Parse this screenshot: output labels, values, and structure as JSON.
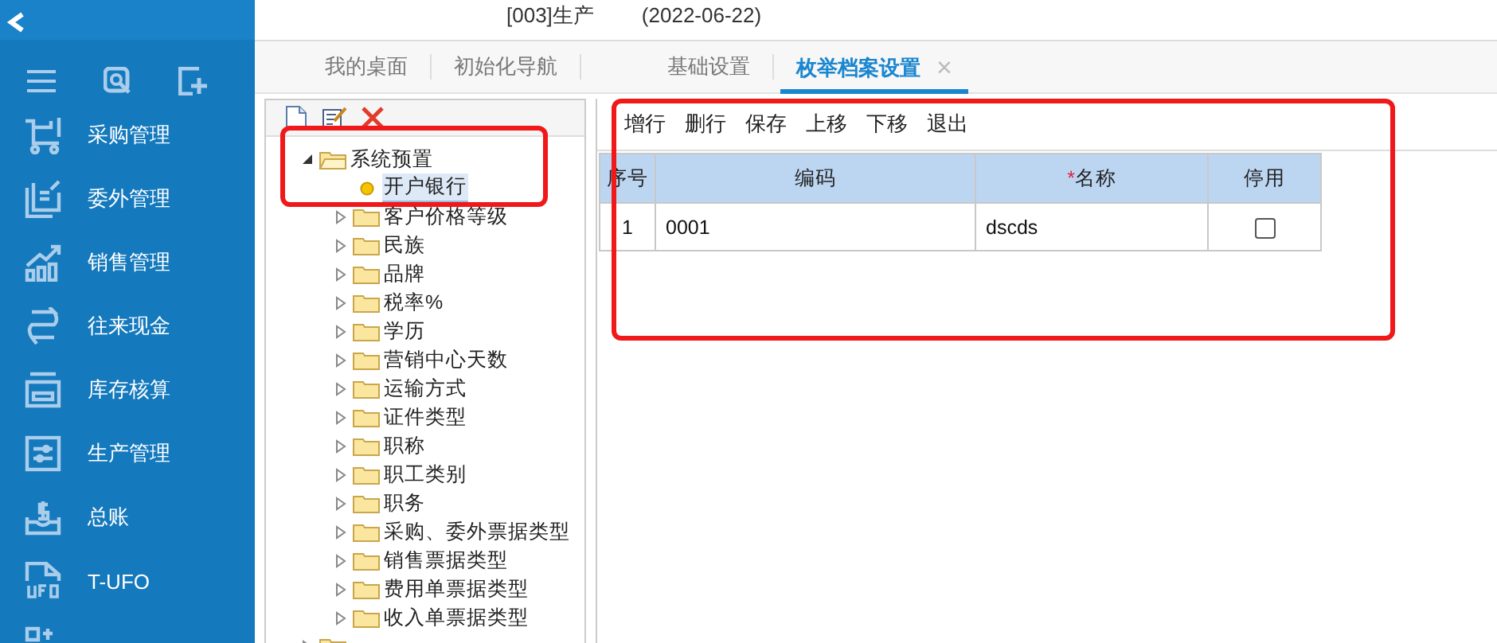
{
  "header": {
    "account": "[003]生产",
    "date": "(2022-06-22)"
  },
  "sidebar": {
    "tools": [
      {
        "kind": "menu"
      },
      {
        "kind": "search"
      },
      {
        "kind": "add"
      }
    ],
    "items": [
      {
        "label": "采购管理",
        "kind": "cart"
      },
      {
        "label": "委外管理",
        "kind": "doc"
      },
      {
        "label": "销售管理",
        "kind": "chart"
      },
      {
        "label": "往来现金",
        "kind": "arrows"
      },
      {
        "label": "库存核算",
        "kind": "tray"
      },
      {
        "label": "生产管理",
        "kind": "sliders"
      },
      {
        "label": "总账",
        "kind": "money"
      },
      {
        "label": "T-UFO",
        "kind": "file"
      },
      {
        "kind": "grid"
      }
    ]
  },
  "tabs": [
    {
      "label": "我的桌面",
      "selected": false,
      "closable": false
    },
    {
      "label": "初始化导航",
      "selected": false,
      "closable": false
    },
    {
      "label": "基础设置",
      "selected": false,
      "closable": false
    },
    {
      "label": "枚举档案设置",
      "selected": true,
      "closable": true,
      "close": "×"
    }
  ],
  "tree": {
    "items": [
      {
        "label": "系统预置",
        "kind": "folder",
        "expanded": true,
        "selected": false,
        "children": [
          {
            "label": "开户银行",
            "kind": "leaf",
            "selected": true
          },
          {
            "label": "客户价格等级",
            "kind": "folder",
            "expanded": false,
            "selected": false
          },
          {
            "label": "民族",
            "kind": "folder",
            "expanded": false,
            "selected": false
          },
          {
            "label": "品牌",
            "kind": "folder",
            "expanded": false,
            "selected": false
          },
          {
            "label": "税率%",
            "kind": "folder",
            "expanded": false,
            "selected": false
          },
          {
            "label": "学历",
            "kind": "folder",
            "expanded": false,
            "selected": false
          },
          {
            "label": "营销中心天数",
            "kind": "folder",
            "expanded": false,
            "selected": false
          },
          {
            "label": "运输方式",
            "kind": "folder",
            "expanded": false,
            "selected": false
          },
          {
            "label": "证件类型",
            "kind": "folder",
            "expanded": false,
            "selected": false
          },
          {
            "label": "职称",
            "kind": "folder",
            "expanded": false,
            "selected": false
          },
          {
            "label": "职工类别",
            "kind": "folder",
            "expanded": false,
            "selected": false
          },
          {
            "label": "职务",
            "kind": "folder",
            "expanded": false,
            "selected": false
          },
          {
            "label": "采购、委外票据类型",
            "kind": "folder",
            "expanded": false,
            "selected": false
          },
          {
            "label": "销售票据类型",
            "kind": "folder",
            "expanded": false,
            "selected": false
          },
          {
            "label": "费用单票据类型",
            "kind": "folder",
            "expanded": false,
            "selected": false
          },
          {
            "label": "收入单票据类型",
            "kind": "folder",
            "expanded": false,
            "selected": false
          }
        ]
      },
      {
        "kind": "folder",
        "expanded": false
      }
    ]
  },
  "toolbar": [
    "增行",
    "删行",
    "保存",
    "上移",
    "下移",
    "退出"
  ],
  "table": {
    "columns": [
      {
        "label": "序号"
      },
      {
        "label": "编码"
      },
      {
        "label": "名称",
        "mark": "*"
      },
      {
        "label": "停用"
      }
    ],
    "rows": [
      {
        "index": "1",
        "code": "0001",
        "name": "dscds",
        "disabled": false
      }
    ]
  }
}
